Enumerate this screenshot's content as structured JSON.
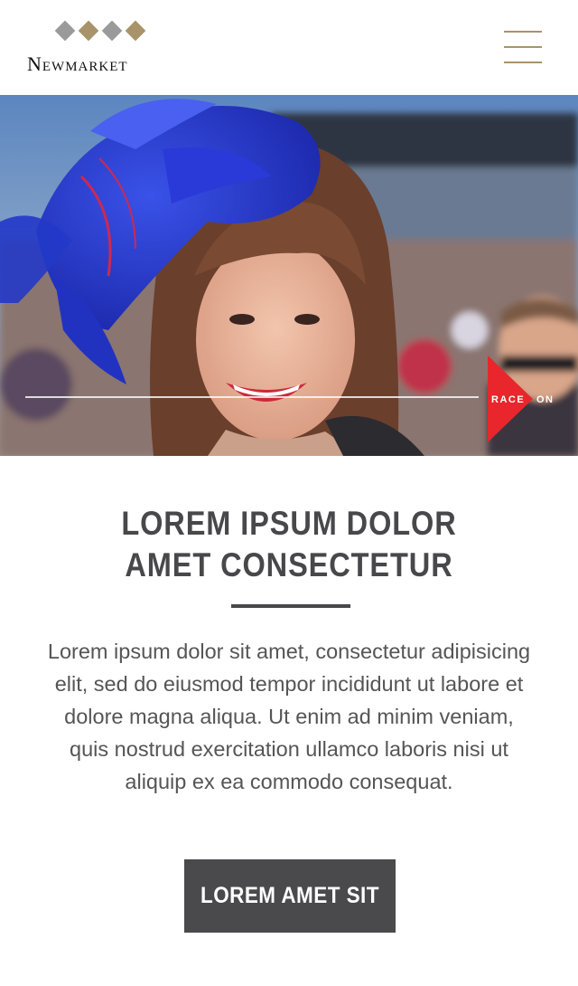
{
  "header": {
    "brand": "Newmarket",
    "logo_colors": [
      "#9a9a9a",
      "#a8936a",
      "#9a9a9a",
      "#a8936a"
    ],
    "menu_icon": "hamburger-menu-icon"
  },
  "hero": {
    "badge_text_left": "RACE",
    "badge_text_right": "ON",
    "badge_color": "#e8262b"
  },
  "content": {
    "heading_line1": "LOREM IPSUM DOLOR",
    "heading_line2": "AMET CONSECTETUR",
    "body": "Lorem ipsum dolor sit amet, consectetur adipisicing elit, sed do eiusmod tempor incididunt ut labore et dolore magna aliqua. Ut enim ad minim veniam, quis nostrud exercitation ullamco laboris nisi ut aliquip ex ea commodo consequat.",
    "cta_label": "LOREM AMET SIT"
  }
}
